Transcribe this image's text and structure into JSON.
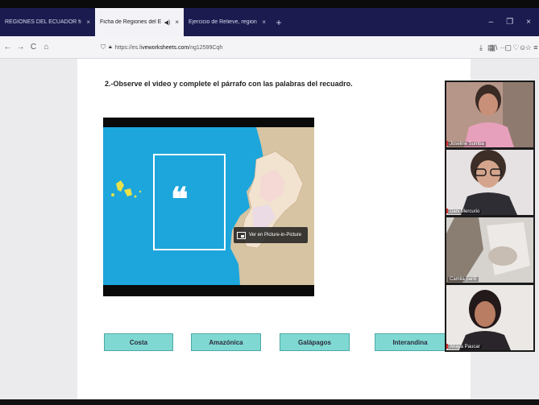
{
  "browser": {
    "tabs": [
      {
        "label": "REGIONES DEL ECUADOR ficha",
        "close": "×"
      },
      {
        "label": "Ficha de Regiones del Ecuador",
        "audio": "◀)",
        "close": "×"
      },
      {
        "label": "Ejercicio de Relieve, regiones natu",
        "close": "×"
      }
    ],
    "new_tab": "+",
    "window_controls": [
      "–",
      "❐",
      "×"
    ],
    "nav": {
      "back": "←",
      "forward": "→",
      "reload": "C",
      "home": "⌂"
    },
    "url_prefix": "https://es.li",
    "url_domain": "veworksheets.com",
    "url_path": "/ng12599Cqh",
    "url_actions": [
      "▤",
      "···",
      "♡",
      "☆"
    ],
    "toolbar_right": [
      "⤓",
      "|||\\",
      "▢",
      "☺",
      "≡"
    ]
  },
  "worksheet": {
    "instruction": "2.-Observe el video y complete el párrafo con las palabras del recuadro.",
    "video": {
      "quote_mark": "❝",
      "pip_label": "Ver en Picture-in-Picture"
    },
    "words": [
      "Costa",
      "Amazónica",
      "Galápagos",
      "Interandina"
    ]
  },
  "participants": [
    {
      "name": "Joseline Sumba"
    },
    {
      "name": "Dani Mercurio"
    },
    {
      "name": "Camila pardi"
    },
    {
      "name": "Anaya Paucar"
    }
  ],
  "colors": {
    "tab_bar": "#1b1b4f",
    "video_sea": "#1ca6dc",
    "word_button": "#7fd9d2"
  }
}
